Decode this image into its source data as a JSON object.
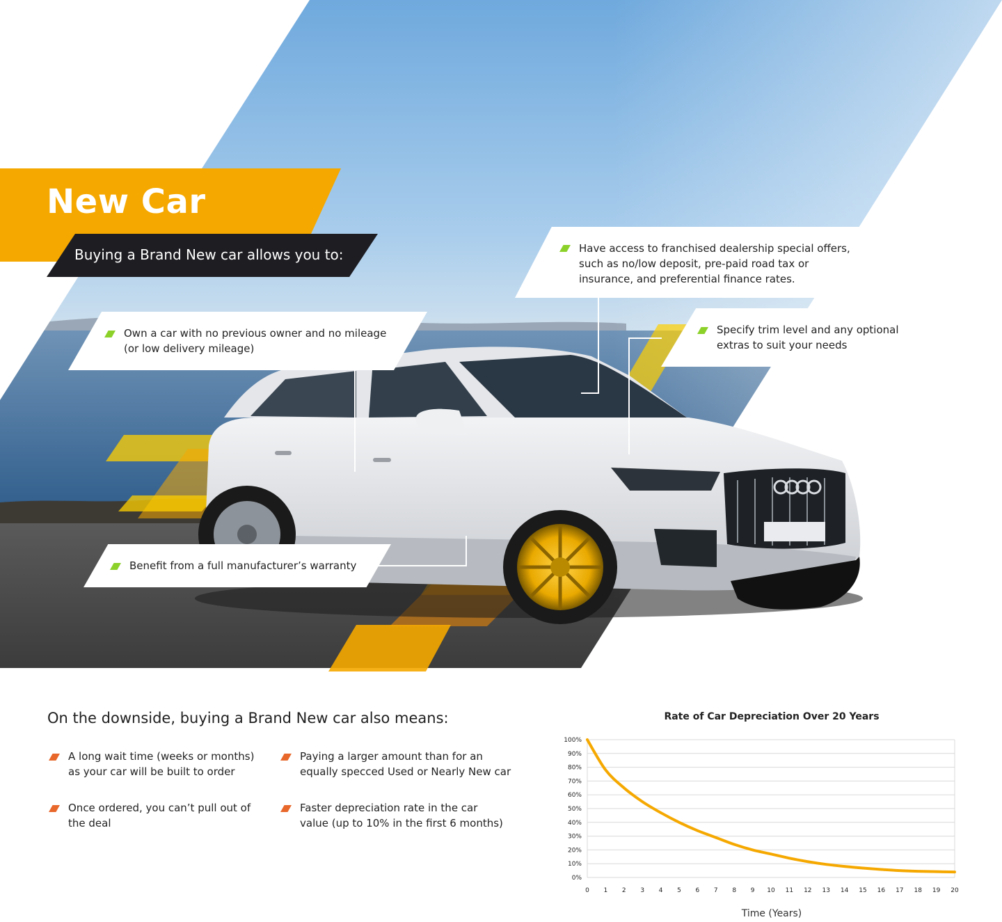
{
  "hero": {
    "title": "New Car",
    "subtitle": "Buying a Brand New car allows you to:",
    "benefits": [
      "Own a car with no previous owner and no mileage (or low delivery mileage)",
      "Have access to franchised dealership special offers, such as no/low deposit, pre-paid road tax or insurance, and preferential finance rates.",
      "Specify trim level and any optional extras to suit your needs",
      "Benefit from a full manufacturer’s warranty"
    ],
    "bullet_icon": "green-parallelogram-bullet-icon"
  },
  "downside": {
    "heading": "On the downside, buying a Brand New car also means:",
    "bullet_icon": "orange-parallelogram-bullet-icon",
    "items": [
      "A long wait time (weeks or months) as your car will be built to order",
      "Paying a larger amount than for an equally specced Used or Nearly New car",
      "Once ordered, you can’t pull out of the deal",
      "Faster depreciation rate in the car value (up to 10% in the first 6 months)"
    ]
  },
  "colors": {
    "accent_orange": "#f5a800",
    "dark_band": "#1e1d22",
    "green_bullet": "#8cd12a",
    "orange_bullet": "#e8672a",
    "curve": "#f5a800"
  },
  "chart_data": {
    "type": "line",
    "title": "Rate of Car Depreciation Over 20 Years",
    "xlabel": "Time (Years)",
    "ylabel": "",
    "x": [
      0,
      1,
      2,
      3,
      4,
      5,
      6,
      7,
      8,
      9,
      10,
      11,
      12,
      13,
      14,
      15,
      16,
      17,
      18,
      19,
      20
    ],
    "x_ticks": [
      "0",
      "1",
      "2",
      "3",
      "4",
      "5",
      "6",
      "7",
      "8",
      "9",
      "10",
      "11",
      "12",
      "13",
      "14",
      "15",
      "16",
      "17",
      "18",
      "19",
      "20"
    ],
    "y_ticks": [
      "0%",
      "10%",
      "20%",
      "30%",
      "40%",
      "50%",
      "60%",
      "70%",
      "80%",
      "90%",
      "100%"
    ],
    "ylim": [
      0,
      100
    ],
    "xlim": [
      0,
      20
    ],
    "grid": true,
    "series": [
      {
        "values": [
          100,
          78,
          65,
          55,
          47,
          40,
          34,
          29,
          24,
          20,
          17,
          14,
          11.5,
          9.5,
          8,
          6.8,
          5.8,
          5,
          4.5,
          4.2,
          4
        ]
      }
    ]
  }
}
